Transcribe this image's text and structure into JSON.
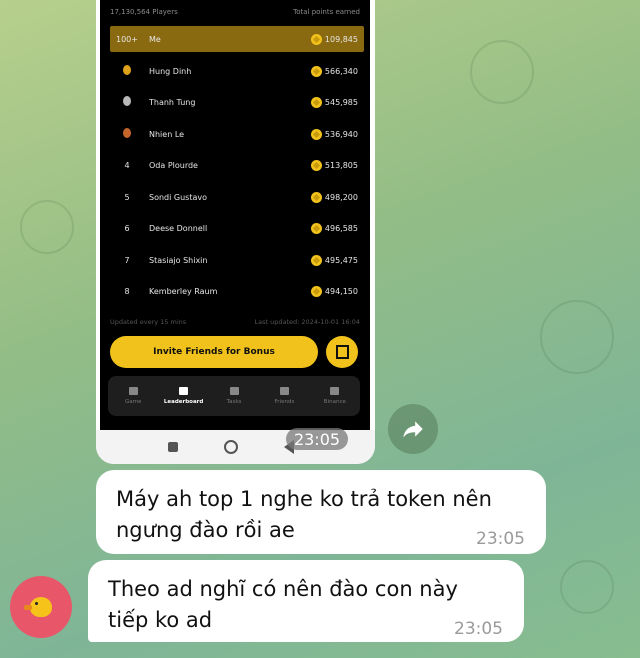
{
  "screenshot": {
    "players_count": "17,130,564 Players",
    "points_header": "Total points earned",
    "rows": [
      {
        "rank": "100+",
        "name": "Me",
        "points": "109,845",
        "highlight": true
      },
      {
        "rank": "gold-medal",
        "name": "Hung Dinh",
        "points": "566,340"
      },
      {
        "rank": "silver-medal",
        "name": "Thanh Tung",
        "points": "545,985"
      },
      {
        "rank": "bronze-medal",
        "name": "Nhien Le",
        "points": "536,940"
      },
      {
        "rank": "4",
        "name": "Oda Plourde",
        "points": "513,805"
      },
      {
        "rank": "5",
        "name": "Sondi Gustavo",
        "points": "498,200"
      },
      {
        "rank": "6",
        "name": "Deese Donnell",
        "points": "496,585"
      },
      {
        "rank": "7",
        "name": "Stasiajo Shixin",
        "points": "495,475"
      },
      {
        "rank": "8",
        "name": "Kemberley Raum",
        "points": "494,150"
      }
    ],
    "update_freq": "Updated every 15 mins",
    "last_updated": "Last updated: 2024-10-01 16:04",
    "invite_label": "Invite Friends for Bonus",
    "tabs": [
      {
        "label": "Game",
        "icon": "home-icon"
      },
      {
        "label": "Leaderboard",
        "icon": "bar-chart-icon",
        "active": true
      },
      {
        "label": "Tasks",
        "icon": "tasks-icon"
      },
      {
        "label": "Friends",
        "icon": "friends-icon"
      },
      {
        "label": "Binance",
        "icon": "binance-icon"
      }
    ],
    "time": "23:05"
  },
  "messages": [
    {
      "line1": "Máy ah top 1 nghe ko trả token nên",
      "line2": "ngưng đào rồi ae",
      "time": "23:05"
    },
    {
      "line1": "Theo ad nghĩ có nên đào con này",
      "line2": "tiếp ko ad",
      "time": "23:05"
    }
  ],
  "colors": {
    "accent": "#f1c21b",
    "highlight_row": "#8a6a10",
    "avatar": "#e8566a"
  }
}
